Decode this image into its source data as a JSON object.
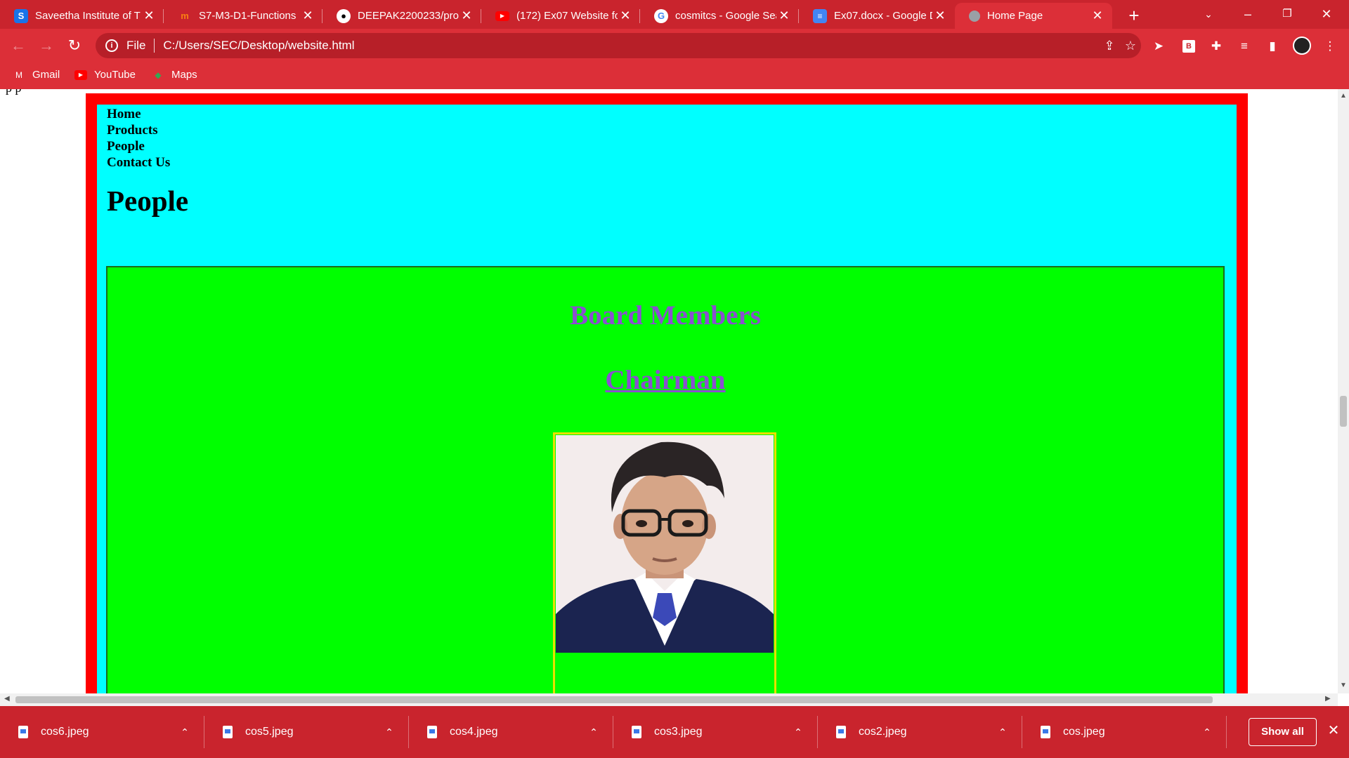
{
  "browser": {
    "tabs": [
      {
        "title": "Saveetha Institute of T",
        "icon": "saveetha-s-icon"
      },
      {
        "title": "S7-M3-D1-Functions",
        "icon": "moodle-icon"
      },
      {
        "title": "DEEPAK2200233/prod",
        "icon": "github-icon"
      },
      {
        "title": "(172) Ex07 Website fo",
        "icon": "youtube-icon"
      },
      {
        "title": "cosmitcs - Google Sea",
        "icon": "google-icon"
      },
      {
        "title": "Ex07.docx - Google D",
        "icon": "google-docs-icon"
      },
      {
        "title": "Home Page",
        "icon": "globe-icon"
      }
    ],
    "active_tab_index": 6,
    "address": {
      "scheme": "File",
      "url": "C:/Users/SEC/Desktop/website.html"
    },
    "bookmarks": [
      {
        "label": "Gmail",
        "icon": "gmail-icon"
      },
      {
        "label": "YouTube",
        "icon": "youtube-icon"
      },
      {
        "label": "Maps",
        "icon": "maps-icon"
      }
    ],
    "colors": {
      "chrome": "#c9242d",
      "toolbar": "#dc2f38"
    }
  },
  "page": {
    "stray_text": "p p",
    "menu": [
      "Home",
      "Products",
      "People",
      "Contact Us"
    ],
    "heading": "People",
    "section_title": "Board Members",
    "subtitle": "Chairman",
    "colors": {
      "outer": "#ff0000",
      "inner": "#00ffff",
      "panel": "#00ff00",
      "title": "#8a4fd0",
      "card_border": "#e8e000"
    }
  },
  "downloads": {
    "files": [
      "cos6.jpeg",
      "cos5.jpeg",
      "cos4.jpeg",
      "cos3.jpeg",
      "cos2.jpeg",
      "cos.jpeg"
    ],
    "show_all_label": "Show all"
  }
}
